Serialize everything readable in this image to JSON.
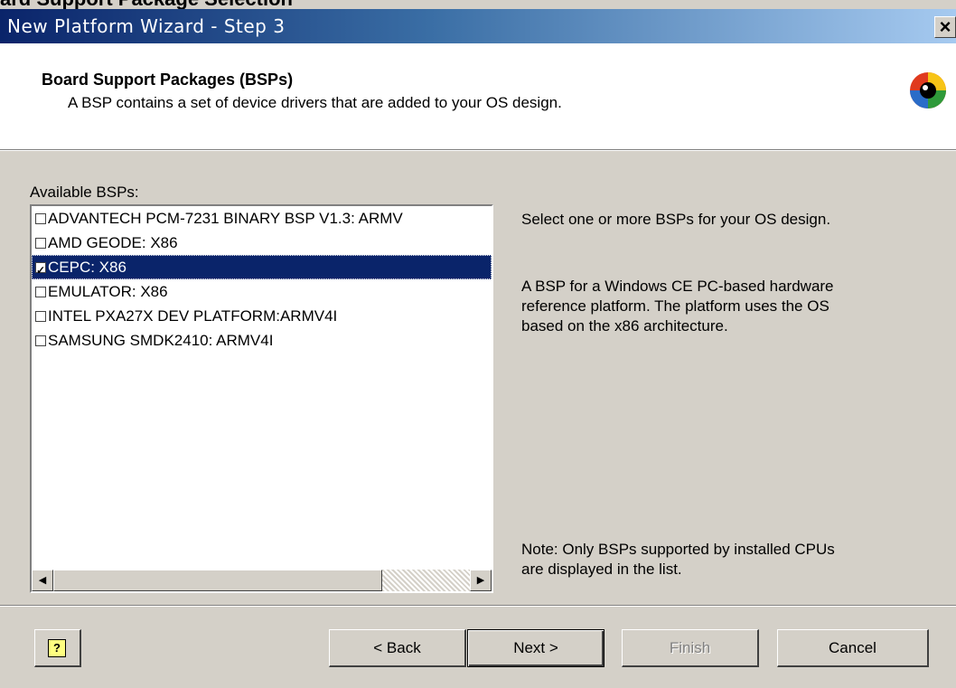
{
  "page_heading": "ard Support Package Selection",
  "window": {
    "title": "New Platform Wizard - Step 3"
  },
  "header": {
    "title": "Board Support Packages (BSPs)",
    "description": "A BSP contains a set of device drivers that are added to your OS design."
  },
  "list": {
    "label": "Available BSPs:",
    "items": [
      {
        "label": "ADVANTECH PCM-7231 BINARY BSP V1.3: ARMV",
        "checked": false,
        "selected": false
      },
      {
        "label": "AMD GEODE: X86",
        "checked": false,
        "selected": false
      },
      {
        "label": "CEPC: X86",
        "checked": true,
        "selected": true
      },
      {
        "label": "EMULATOR: X86",
        "checked": false,
        "selected": false
      },
      {
        "label": "INTEL PXA27X DEV PLATFORM:ARMV4I",
        "checked": false,
        "selected": false
      },
      {
        "label": "SAMSUNG SMDK2410: ARMV4I",
        "checked": false,
        "selected": false
      }
    ]
  },
  "info": {
    "instruction": "Select one or more BSPs for your OS design.",
    "desc_lines": [
      "A BSP for a Windows CE PC-based hardware",
      "reference platform.  The platform uses the OS",
      "based on the x86 architecture."
    ],
    "note_lines": [
      "Note:  Only BSPs supported by installed CPUs",
      "are displayed in the list."
    ]
  },
  "buttons": {
    "help": "?",
    "back": "< Back",
    "next": "Next >",
    "finish": "Finish",
    "cancel": "Cancel"
  },
  "close_symbol": "×",
  "colors": {
    "titlebar_start": "#0a246a",
    "titlebar_end": "#a6caf0",
    "selection": "#0a246a",
    "face": "#d4d0c8"
  }
}
